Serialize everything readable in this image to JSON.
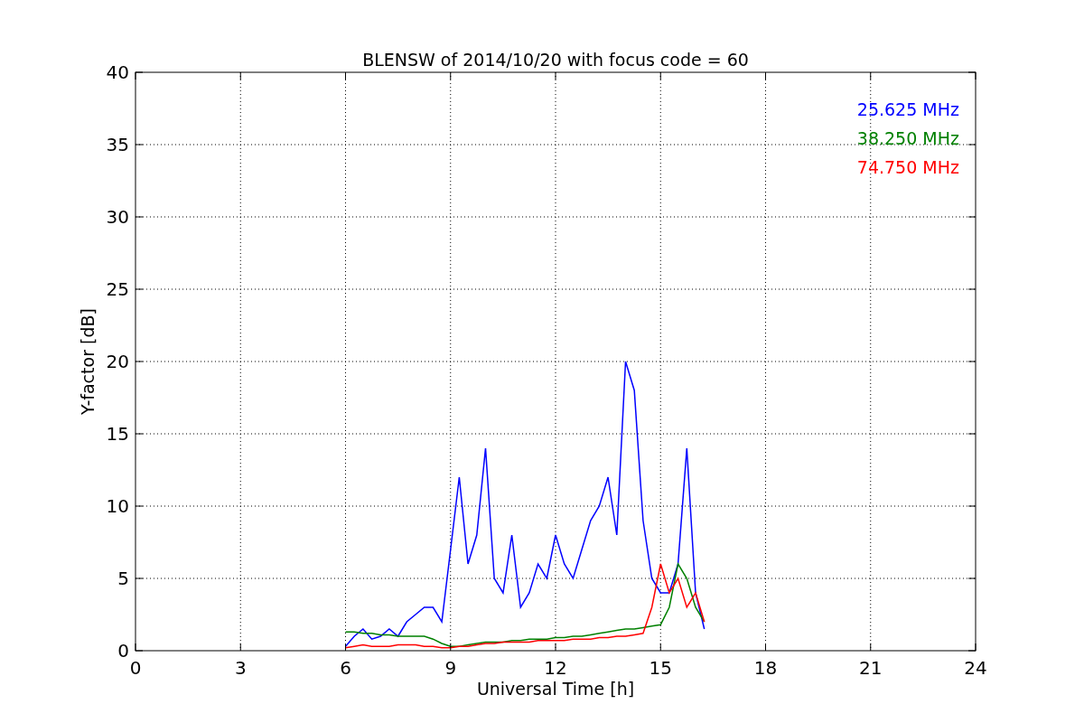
{
  "chart_data": {
    "type": "line",
    "title": "BLENSW of 2014/10/20 with focus code = 60",
    "xlabel": "Universal Time [h]",
    "ylabel": "Y-factor [dB]",
    "grid": true,
    "xlim": [
      0,
      24
    ],
    "ylim": [
      0,
      40
    ],
    "xticks": [
      0,
      3,
      6,
      9,
      12,
      15,
      18,
      21,
      24
    ],
    "yticks": [
      0,
      5,
      10,
      15,
      20,
      25,
      30,
      35,
      40
    ],
    "x": [
      6,
      6.25,
      6.5,
      6.75,
      7,
      7.25,
      7.5,
      7.75,
      8,
      8.25,
      8.5,
      8.75,
      9,
      9.25,
      9.5,
      9.75,
      10,
      10.25,
      10.5,
      10.75,
      11,
      11.25,
      11.5,
      11.75,
      12,
      12.25,
      12.5,
      12.75,
      13,
      13.25,
      13.5,
      13.75,
      14,
      14.25,
      14.5,
      14.75,
      15,
      15.25,
      15.5,
      15.75,
      16,
      16.25
    ],
    "series": [
      {
        "name": "25.625 MHz",
        "color": "#0000ff",
        "values": [
          0.3,
          1,
          1.5,
          0.8,
          1,
          1.5,
          1,
          2,
          2.5,
          3,
          3,
          2,
          7,
          12,
          6,
          8,
          14,
          5,
          4,
          8,
          3,
          4,
          6,
          5,
          8,
          6,
          5,
          7,
          9,
          10,
          12,
          8,
          20,
          18,
          9,
          5,
          4,
          4,
          6,
          14,
          4,
          1.5
        ]
      },
      {
        "name": "38.250 MHz",
        "color": "#008000",
        "values": [
          1.3,
          1.3,
          1.2,
          1.2,
          1.1,
          1.1,
          1.0,
          1.0,
          1.0,
          1.0,
          0.8,
          0.5,
          0.3,
          0.3,
          0.4,
          0.5,
          0.6,
          0.6,
          0.6,
          0.7,
          0.7,
          0.8,
          0.8,
          0.8,
          0.9,
          0.9,
          1.0,
          1.0,
          1.1,
          1.2,
          1.3,
          1.4,
          1.5,
          1.5,
          1.6,
          1.7,
          1.8,
          3,
          6,
          5,
          3,
          2
        ]
      },
      {
        "name": "74.750 MHz",
        "color": "#ff0000",
        "values": [
          0.2,
          0.3,
          0.4,
          0.3,
          0.3,
          0.3,
          0.4,
          0.4,
          0.4,
          0.3,
          0.3,
          0.2,
          0.2,
          0.3,
          0.3,
          0.4,
          0.5,
          0.5,
          0.6,
          0.6,
          0.6,
          0.6,
          0.7,
          0.7,
          0.7,
          0.7,
          0.8,
          0.8,
          0.8,
          0.9,
          0.9,
          1.0,
          1.0,
          1.1,
          1.2,
          3,
          6,
          4,
          5,
          3,
          4,
          2
        ]
      }
    ]
  }
}
